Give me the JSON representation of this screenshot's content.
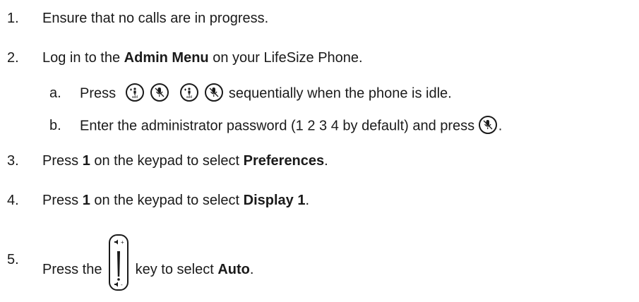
{
  "steps": [
    {
      "num": "1.",
      "text": "Ensure that no calls are in progress."
    },
    {
      "num": "2.",
      "pre": "Log in to the ",
      "bold": "Admin Menu",
      "post": " on your LifeSize Phone."
    },
    {
      "num": "a.",
      "pre": "Press",
      "post": " sequentially when the phone is idle."
    },
    {
      "num": "b.",
      "pre": "Enter the administrator password (1 2 3 4 by default) and press ",
      "post": "."
    },
    {
      "num": "3.",
      "pre": "Press ",
      "bold1": "1",
      "mid": " on the keypad to select ",
      "bold2": "Preferences",
      "post": "."
    },
    {
      "num": "4.",
      "pre": "Press ",
      "bold1": "1",
      "mid": " on the keypad to select ",
      "bold2": "Display 1",
      "post": "."
    },
    {
      "num": "5.",
      "pre": "Press the ",
      "mid": " key to select ",
      "bold": "Auto",
      "post": "."
    }
  ],
  "icons": {
    "add_label": "add",
    "vol_up": "+",
    "vol_down": "-"
  }
}
